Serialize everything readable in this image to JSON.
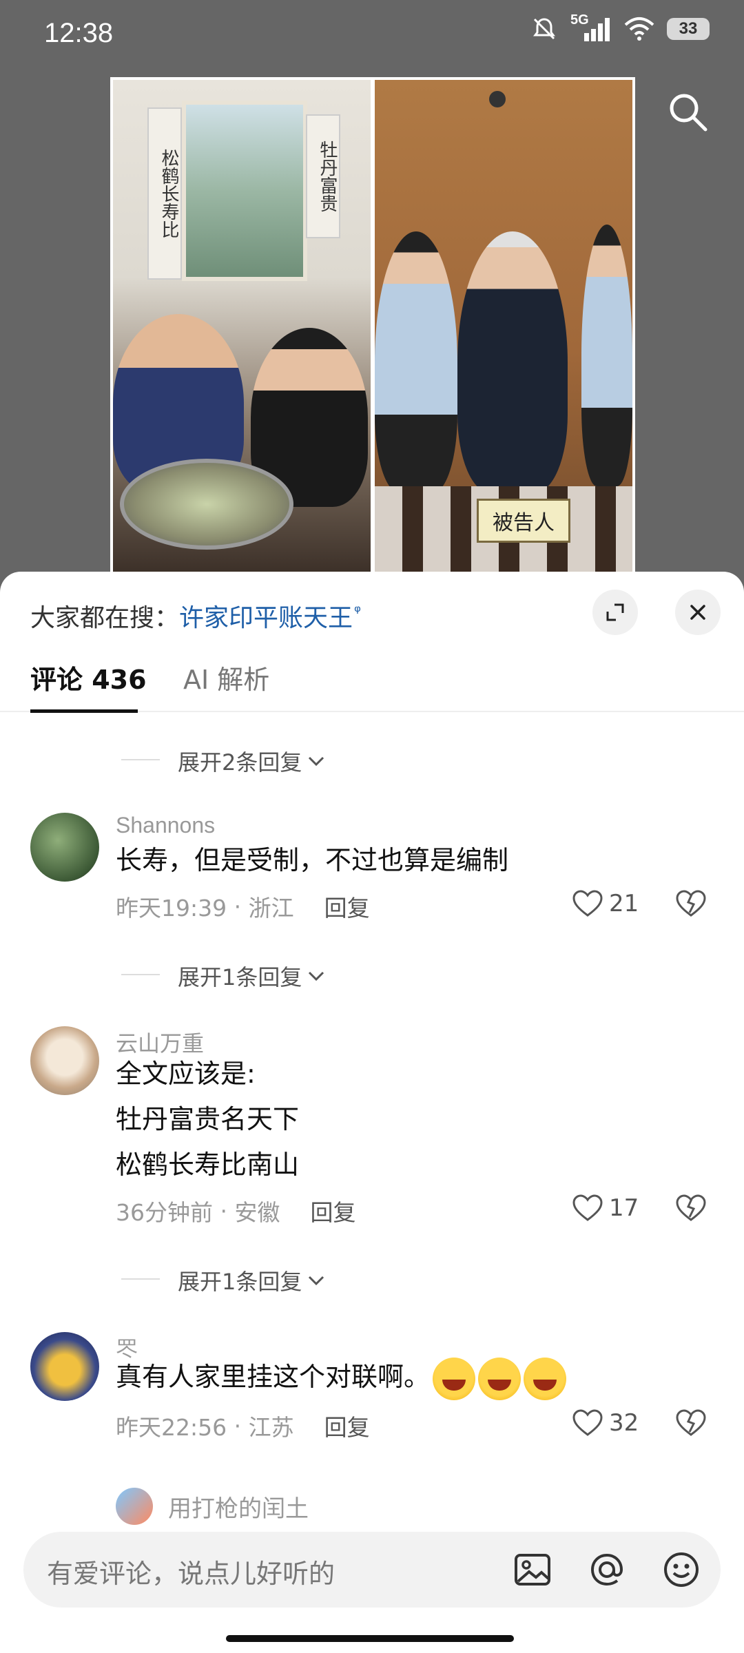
{
  "status_bar": {
    "time": "12:38",
    "network": "5G",
    "battery": "33",
    "icons": [
      "mute-bell-icon",
      "signal-icon",
      "wifi-icon",
      "battery-icon"
    ]
  },
  "video": {
    "couplet_left": "松鹤长寿比",
    "couplet_right": "牡丹富贵",
    "sign_text": "被告人"
  },
  "sheet": {
    "trending_label": "大家都在搜：",
    "trending_term": "许家印平账天王",
    "trending_search_glyph": "ᵠ",
    "tabs": [
      {
        "label": "评论 436",
        "active": true
      },
      {
        "label": "AI 解析",
        "active": false
      }
    ],
    "expand_replies_top": "展开2条回复",
    "comments": [
      {
        "username": "Shannons",
        "lines": [
          "长寿，但是受制，不过也算是编制"
        ],
        "time": "昨天19:39",
        "location": "浙江",
        "reply_label": "回复",
        "likes": "21",
        "expand_replies": "展开1条回复"
      },
      {
        "username": "云山万重",
        "lines": [
          "全文应该是:",
          "牡丹富贵名天下",
          "松鹤长寿比南山"
        ],
        "time": "36分钟前",
        "location": "安徽",
        "reply_label": "回复",
        "likes": "17",
        "expand_replies": "展开1条回复"
      },
      {
        "username": "罖",
        "lines": [
          "真有人家里挂这个对联啊。"
        ],
        "emojis": 3,
        "time": "昨天22:56",
        "location": "江苏",
        "reply_label": "回复",
        "likes": "32"
      }
    ],
    "peek_username": "用打枪的闰土",
    "input_placeholder": "有爱评论，说点儿好听的"
  },
  "colors": {
    "background_dim": "#666666",
    "trending_term": "#1f5fa8",
    "text_primary": "#111111",
    "text_secondary": "#999999"
  }
}
